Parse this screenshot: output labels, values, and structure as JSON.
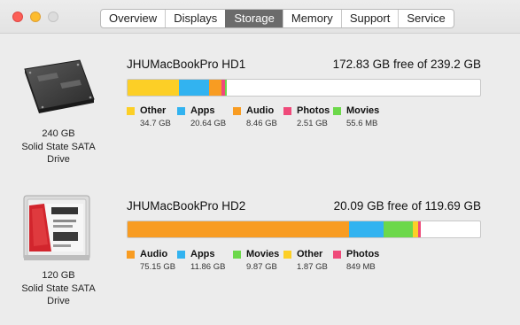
{
  "window": {
    "tabs": [
      {
        "label": "Overview",
        "active": false
      },
      {
        "label": "Displays",
        "active": false
      },
      {
        "label": "Storage",
        "active": true
      },
      {
        "label": "Memory",
        "active": false
      },
      {
        "label": "Support",
        "active": false
      },
      {
        "label": "Service",
        "active": false
      }
    ]
  },
  "colors": {
    "other": "#fccf26",
    "apps": "#32b3f0",
    "audio": "#f89c22",
    "photos": "#ef4a7a",
    "movies": "#6cd84a",
    "bar_empty": "#ffffff"
  },
  "drives": [
    {
      "capacity": "240 GB",
      "type_line1": "Solid State SATA",
      "type_line2": "Drive",
      "volume": "JHUMacBookPro HD1",
      "free_text": "172.83 GB free of 239.2 GB",
      "total_gb": 239.2,
      "free_gb": 172.83,
      "categories": [
        {
          "name": "Other",
          "size": "34.7 GB",
          "gb": 34.7,
          "color": "#fccf26"
        },
        {
          "name": "Apps",
          "size": "20.64 GB",
          "gb": 20.64,
          "color": "#32b3f0"
        },
        {
          "name": "Audio",
          "size": "8.46 GB",
          "gb": 8.46,
          "color": "#f89c22"
        },
        {
          "name": "Photos",
          "size": "2.51 GB",
          "gb": 2.51,
          "color": "#ef4a7a"
        },
        {
          "name": "Movies",
          "size": "55.6 MB",
          "gb": 0.0556,
          "color": "#6cd84a"
        }
      ]
    },
    {
      "capacity": "120 GB",
      "type_line1": "Solid State SATA",
      "type_line2": "Drive",
      "volume": "JHUMacBookPro HD2",
      "free_text": "20.09 GB free of 119.69 GB",
      "total_gb": 119.69,
      "free_gb": 20.09,
      "categories": [
        {
          "name": "Audio",
          "size": "75.15 GB",
          "gb": 75.15,
          "color": "#f89c22"
        },
        {
          "name": "Apps",
          "size": "11.86 GB",
          "gb": 11.86,
          "color": "#32b3f0"
        },
        {
          "name": "Movies",
          "size": "9.87 GB",
          "gb": 9.87,
          "color": "#6cd84a"
        },
        {
          "name": "Other",
          "size": "1.87 GB",
          "gb": 1.87,
          "color": "#fccf26"
        },
        {
          "name": "Photos",
          "size": "849 MB",
          "gb": 0.849,
          "color": "#ef4a7a"
        }
      ]
    }
  ]
}
